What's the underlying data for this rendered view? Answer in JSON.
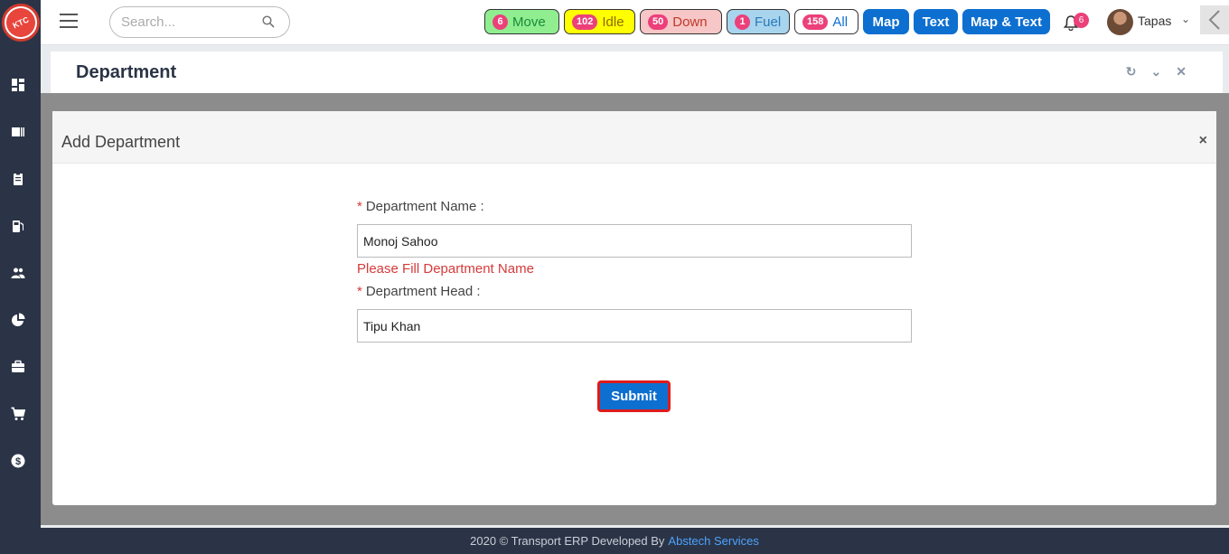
{
  "search": {
    "placeholder": "Search..."
  },
  "status_pills": [
    {
      "count": "6",
      "label": "Move",
      "bg": "#90ee90",
      "color": "#1a8a3a"
    },
    {
      "count": "102",
      "label": "Idle",
      "bg": "#ffff00",
      "color": "#8a6a00"
    },
    {
      "count": "50",
      "label": "Down",
      "bg": "#f7c6c6",
      "color": "#c0392b"
    },
    {
      "count": "1",
      "label": "Fuel",
      "bg": "#a9d4ee",
      "color": "#2a7ab8"
    },
    {
      "count": "158",
      "label": "All",
      "bg": "#ffffff",
      "color": "#0d6fd0"
    }
  ],
  "view_buttons": {
    "map": "Map",
    "text": "Text",
    "map_text": "Map & Text"
  },
  "notifications": {
    "count": "6"
  },
  "user": {
    "name": "Tapas"
  },
  "page": {
    "title": "Department"
  },
  "modal": {
    "title": "Add Department",
    "close_glyph": "×",
    "fields": {
      "department_name": {
        "label": "Department Name :",
        "value": "Monoj Sahoo",
        "error": "Please Fill Department Name"
      },
      "department_head": {
        "label": "Department Head :",
        "value": "Tipu Khan"
      }
    },
    "submit_label": "Submit"
  },
  "footer": {
    "text": "2020 © Transport ERP Developed By",
    "link": "Abstech Services"
  },
  "logo_text": "KTC",
  "colors": {
    "accent": "#0d6fd0",
    "error": "#d63a3a",
    "sidebar": "#2b3446"
  }
}
